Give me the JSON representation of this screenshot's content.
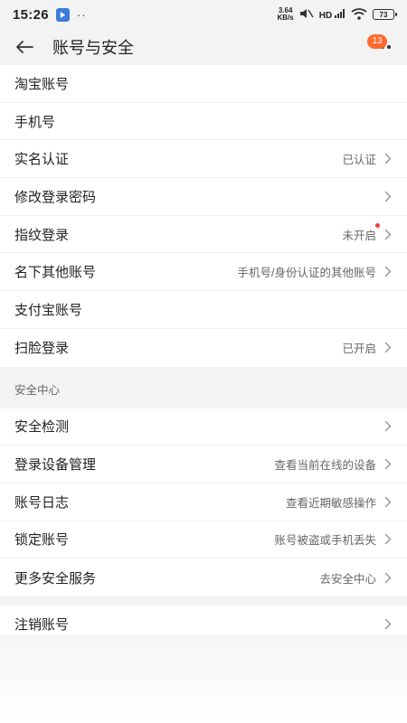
{
  "status_bar": {
    "time": "15:26",
    "dots": "··",
    "net_speed_value": "3.64",
    "net_speed_unit": "KB/s",
    "signal_label": "HD",
    "battery": "73"
  },
  "header": {
    "title": "账号与安全",
    "badge_count": "13"
  },
  "group1": [
    {
      "label": "淘宝账号",
      "value": "",
      "chevron": false
    },
    {
      "label": "手机号",
      "value": "",
      "chevron": false
    },
    {
      "label": "实名认证",
      "value": "已认证",
      "chevron": true
    },
    {
      "label": "修改登录密码",
      "value": "",
      "chevron": true
    },
    {
      "label": "指纹登录",
      "value": "未开启",
      "chevron": true,
      "dot": true
    },
    {
      "label": "名下其他账号",
      "value": "手机号/身份认证的其他账号",
      "chevron": true
    },
    {
      "label": "支付宝账号",
      "value": "",
      "chevron": false
    },
    {
      "label": "扫脸登录",
      "value": "已开启",
      "chevron": true
    }
  ],
  "section_title": "安全中心",
  "group2": [
    {
      "label": "安全检测",
      "value": "",
      "chevron": true
    },
    {
      "label": "登录设备管理",
      "value": "查看当前在线的设备",
      "chevron": true
    },
    {
      "label": "账号日志",
      "value": "查看近期敏感操作",
      "chevron": true
    },
    {
      "label": "锁定账号",
      "value": "账号被盗或手机丢失",
      "chevron": true
    },
    {
      "label": "更多安全服务",
      "value": "去安全中心",
      "chevron": true
    }
  ],
  "group3": [
    {
      "label": "注销账号",
      "value": "",
      "chevron": true
    }
  ],
  "colors": {
    "badge": "#ff6a2e",
    "dot": "#f23b3b",
    "background": "#f3f3f3"
  }
}
